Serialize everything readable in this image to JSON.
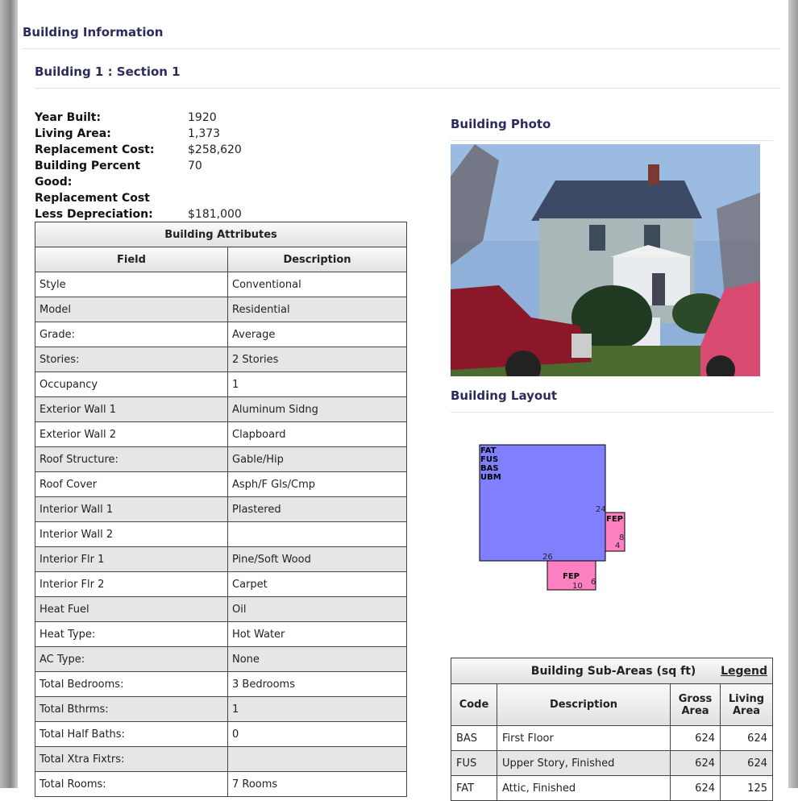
{
  "section_title": "Building Information",
  "building_title": "Building 1 : Section 1",
  "info": [
    {
      "label": "Year Built:",
      "value": "1920"
    },
    {
      "label": "Living Area:",
      "value": "1,373"
    },
    {
      "label": "Replacement Cost:",
      "value": "$258,620"
    },
    {
      "label": "Building Percent",
      "value": "70"
    },
    {
      "label": "Good:",
      "value": ""
    },
    {
      "label": "Replacement Cost",
      "value": ""
    },
    {
      "label": "Less Depreciation:",
      "value": "$181,000"
    }
  ],
  "attributes": {
    "title": "Building Attributes",
    "headers": [
      "Field",
      "Description"
    ],
    "rows": [
      [
        "Style",
        "Conventional"
      ],
      [
        "Model",
        "Residential"
      ],
      [
        "Grade:",
        "Average"
      ],
      [
        "Stories:",
        "2 Stories"
      ],
      [
        "Occupancy",
        "1"
      ],
      [
        "Exterior Wall 1",
        "Aluminum Sidng"
      ],
      [
        "Exterior Wall 2",
        "Clapboard"
      ],
      [
        "Roof Structure:",
        "Gable/Hip"
      ],
      [
        "Roof Cover",
        "Asph/F Gls/Cmp"
      ],
      [
        "Interior Wall 1",
        "Plastered"
      ],
      [
        "Interior Wall 2",
        ""
      ],
      [
        "Interior Flr 1",
        "Pine/Soft Wood"
      ],
      [
        "Interior Flr 2",
        "Carpet"
      ],
      [
        "Heat Fuel",
        "Oil"
      ],
      [
        "Heat Type:",
        "Hot Water"
      ],
      [
        "AC Type:",
        "None"
      ],
      [
        "Total Bedrooms:",
        "3 Bedrooms"
      ],
      [
        "Total Bthrms:",
        "1"
      ],
      [
        "Total Half Baths:",
        "0"
      ],
      [
        "Total Xtra Fixtrs:",
        ""
      ],
      [
        "Total Rooms:",
        "7 Rooms"
      ]
    ]
  },
  "photo_title": "Building Photo",
  "layout_title": "Building Layout",
  "layout_labels": {
    "main_codes": [
      "FAT",
      "FUS",
      "BAS",
      "UBM"
    ],
    "main_dim_side": "24",
    "main_dim_bottom": "26",
    "porch1": "FEP",
    "porch1_h": "8",
    "porch1_w": "4",
    "porch2": "FEP",
    "porch2_w": "10",
    "porch2_h": "6"
  },
  "subareas": {
    "title": "Building Sub-Areas (sq ft)",
    "legend": "Legend",
    "headers": [
      "Code",
      "Description",
      "Gross Area",
      "Living Area"
    ],
    "rows": [
      [
        "BAS",
        "First Floor",
        "624",
        "624"
      ],
      [
        "FUS",
        "Upper Story, Finished",
        "624",
        "624"
      ],
      [
        "FAT",
        "Attic, Finished",
        "624",
        "125"
      ]
    ]
  }
}
